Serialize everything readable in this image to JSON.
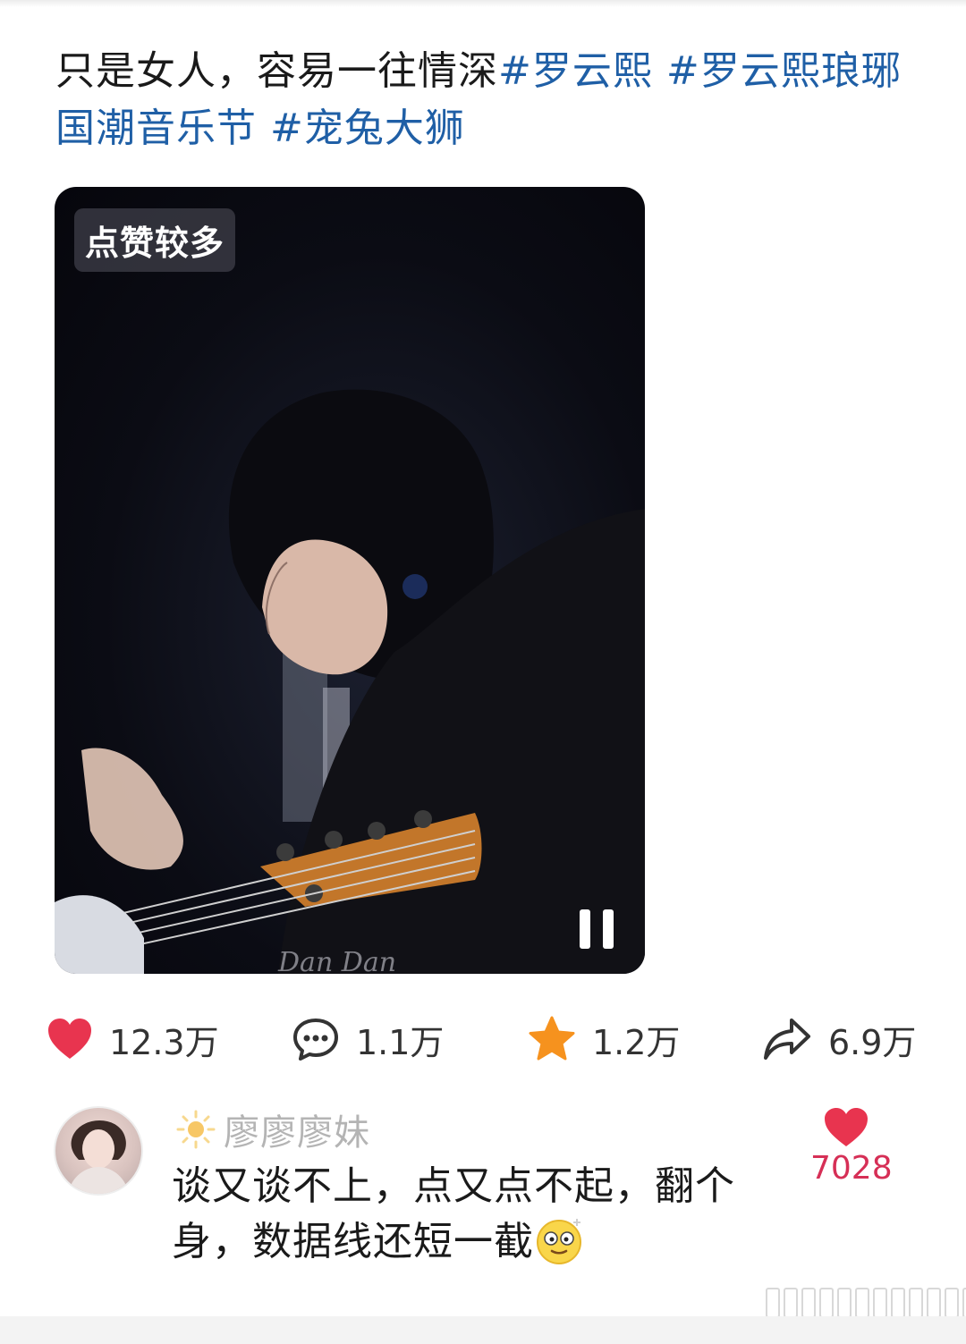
{
  "post": {
    "text": "只是女人，容易一往情深",
    "tags": [
      "#罗云熙",
      "#罗云熙琅琊国潮音乐节",
      "#宠兔大狮"
    ]
  },
  "video": {
    "badge": "点赞较多",
    "watermark": "Dan Dan",
    "pause_icon": "pause-icon"
  },
  "actions": {
    "like": {
      "icon": "heart-icon",
      "count": "12.3万"
    },
    "comment": {
      "icon": "comment-bubble-icon",
      "count": "1.1万"
    },
    "favorite": {
      "icon": "star-icon",
      "count": "1.2万"
    },
    "share": {
      "icon": "share-arrow-icon",
      "count": "6.9万"
    }
  },
  "comment": {
    "username": "廖廖廖妹",
    "badge_icon": "sun-icon",
    "text": "谈又谈不上，点又点不起，翻个身，数据线还短一截",
    "emoji": "dizzy-face-emoji",
    "like_count": "7028"
  },
  "colors": {
    "tag": "#1f5fa6",
    "heart": "#e8344f",
    "star": "#f6921e",
    "comment_like": "#d62f56"
  }
}
